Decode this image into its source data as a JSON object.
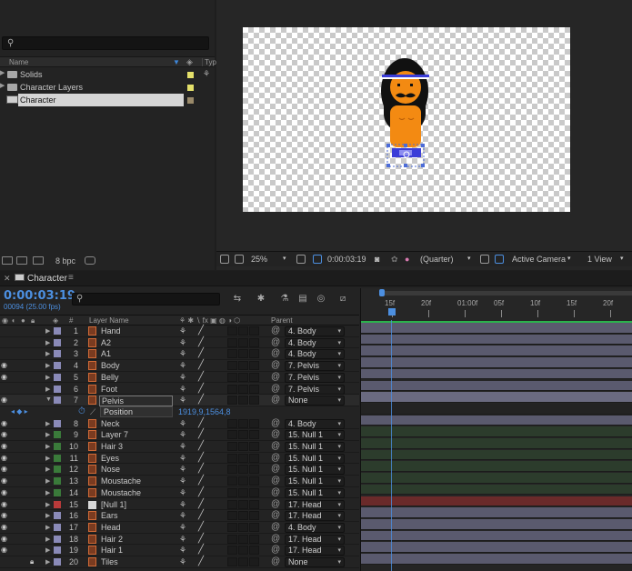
{
  "project": {
    "col_name": "Name",
    "col_type": "Typ",
    "items": [
      {
        "label": "Solids",
        "kind": "folder",
        "color": "#e4e06a"
      },
      {
        "label": "Character Layers",
        "kind": "folder",
        "color": "#e4e06a"
      },
      {
        "label": "Character",
        "kind": "comp",
        "color": "#9a8a6a",
        "selected": true
      }
    ],
    "bpc": "8 bpc"
  },
  "viewer": {
    "zoom": "25%",
    "time": "0:00:03:19",
    "resolution": "(Quarter)",
    "camera": "Active Camera",
    "views": "1 View"
  },
  "timeline": {
    "tab": "Character",
    "timecode": "0:00:03:19",
    "frames": "00094 (25.00 fps)",
    "headers": {
      "num": "#",
      "layer_name": "Layer Name",
      "parent": "Parent"
    },
    "ruler": [
      "15f",
      "20f",
      "01:00f",
      "05f",
      "10f",
      "15f",
      "20f"
    ],
    "layers": [
      {
        "num": "1",
        "name": "Hand",
        "parent": "4. Body",
        "color": "#8a8ab8",
        "eye": false,
        "bar": "#5a5a6e"
      },
      {
        "num": "2",
        "name": "A2",
        "parent": "4. Body",
        "color": "#8a8ab8",
        "eye": false,
        "bar": "#5a5a6e"
      },
      {
        "num": "3",
        "name": "A1",
        "parent": "4. Body",
        "color": "#8a8ab8",
        "eye": false,
        "bar": "#5a5a6e"
      },
      {
        "num": "4",
        "name": "Body",
        "parent": "7. Pelvis",
        "color": "#8a8ab8",
        "eye": true,
        "bar": "#5a5a6e"
      },
      {
        "num": "5",
        "name": "Belly",
        "parent": "7. Pelvis",
        "color": "#8a8ab8",
        "eye": true,
        "bar": "#5a5a6e"
      },
      {
        "num": "6",
        "name": "Foot",
        "parent": "7. Pelvis",
        "color": "#8a8ab8",
        "eye": false,
        "bar": "#5a5a6e"
      },
      {
        "num": "7",
        "name": "Pelvis",
        "parent": "None",
        "color": "#8a8ab8",
        "eye": true,
        "bar": "#6a6a80",
        "selected": true,
        "expanded": true
      },
      {
        "num": "8",
        "name": "Neck",
        "parent": "4. Body",
        "color": "#8a8ab8",
        "eye": true,
        "bar": "#5a5a6e"
      },
      {
        "num": "9",
        "name": "Layer 7",
        "parent": "15. Null 1",
        "color": "#3a7a3a",
        "eye": true,
        "bar": "#2c3c2c"
      },
      {
        "num": "10",
        "name": "Hair 3",
        "parent": "15. Null 1",
        "color": "#3a7a3a",
        "eye": true,
        "bar": "#2c3c2c"
      },
      {
        "num": "11",
        "name": "Eyes",
        "parent": "15. Null 1",
        "color": "#3a7a3a",
        "eye": true,
        "bar": "#2c3c2c"
      },
      {
        "num": "12",
        "name": "Nose",
        "parent": "15. Null 1",
        "color": "#3a7a3a",
        "eye": true,
        "bar": "#2c3c2c"
      },
      {
        "num": "13",
        "name": "Moustache",
        "parent": "15. Null 1",
        "color": "#3a7a3a",
        "eye": true,
        "bar": "#2c3c2c"
      },
      {
        "num": "14",
        "name": "Moustache",
        "parent": "15. Null 1",
        "color": "#3a7a3a",
        "eye": true,
        "bar": "#2c3c2c"
      },
      {
        "num": "15",
        "name": "[Null 1]",
        "parent": "17. Head",
        "color": "#b83a3a",
        "eye": true,
        "bar": "#6a2a2a",
        "null": true
      },
      {
        "num": "16",
        "name": "Ears",
        "parent": "17. Head",
        "color": "#8a8ab8",
        "eye": true,
        "bar": "#5a5a6e"
      },
      {
        "num": "17",
        "name": "Head",
        "parent": "4. Body",
        "color": "#8a8ab8",
        "eye": true,
        "bar": "#5a5a6e"
      },
      {
        "num": "18",
        "name": "Hair 2",
        "parent": "17. Head",
        "color": "#8a8ab8",
        "eye": true,
        "bar": "#5a5a6e"
      },
      {
        "num": "19",
        "name": "Hair 1",
        "parent": "17. Head",
        "color": "#8a8ab8",
        "eye": true,
        "bar": "#5a5a6e"
      },
      {
        "num": "20",
        "name": "Tiles",
        "parent": "None",
        "color": "#8a8ab8",
        "eye": false,
        "lock": true,
        "bar": "#5a5a6e"
      }
    ],
    "position_property": {
      "name": "Position",
      "value": "1919,9,1564,8"
    }
  }
}
